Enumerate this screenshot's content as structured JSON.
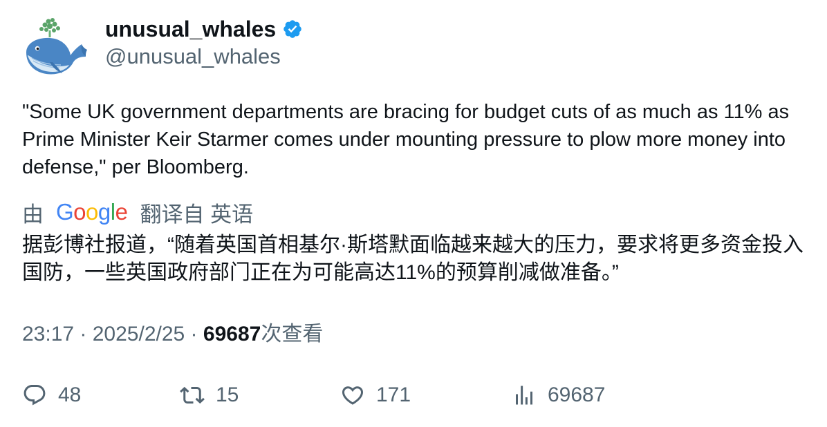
{
  "author": {
    "display_name": "unusual_whales",
    "handle": "@unusual_whales",
    "verified": true,
    "avatar_icon": "whale-logo-icon",
    "verified_color": "#1d9bf0"
  },
  "tweet": {
    "text": "\"Some UK government departments are bracing for budget cuts of as much as 11% as Prime Minister Keir Starmer comes under mounting pressure to plow more money into defense,\" per Bloomberg."
  },
  "translation": {
    "prefix": "由",
    "provider": "Google",
    "suffix": "翻译自 英语",
    "text": "据彭博社报道，“随着英国首相基尔·斯塔默面临越来越大的压力，要求将更多资金投入国防，一些英国政府部门正在为可能高达11%的预算削减做准备。”"
  },
  "meta": {
    "time": "23:17",
    "separator1": " · ",
    "date": "2025/2/25",
    "separator2": " · ",
    "views_count": "69687",
    "views_label": "次查看"
  },
  "actions": {
    "replies": "48",
    "retweets": "15",
    "likes": "171",
    "views": "69687"
  },
  "colors": {
    "text_primary": "#0f1419",
    "text_secondary": "#536471",
    "verified": "#1d9bf0"
  }
}
